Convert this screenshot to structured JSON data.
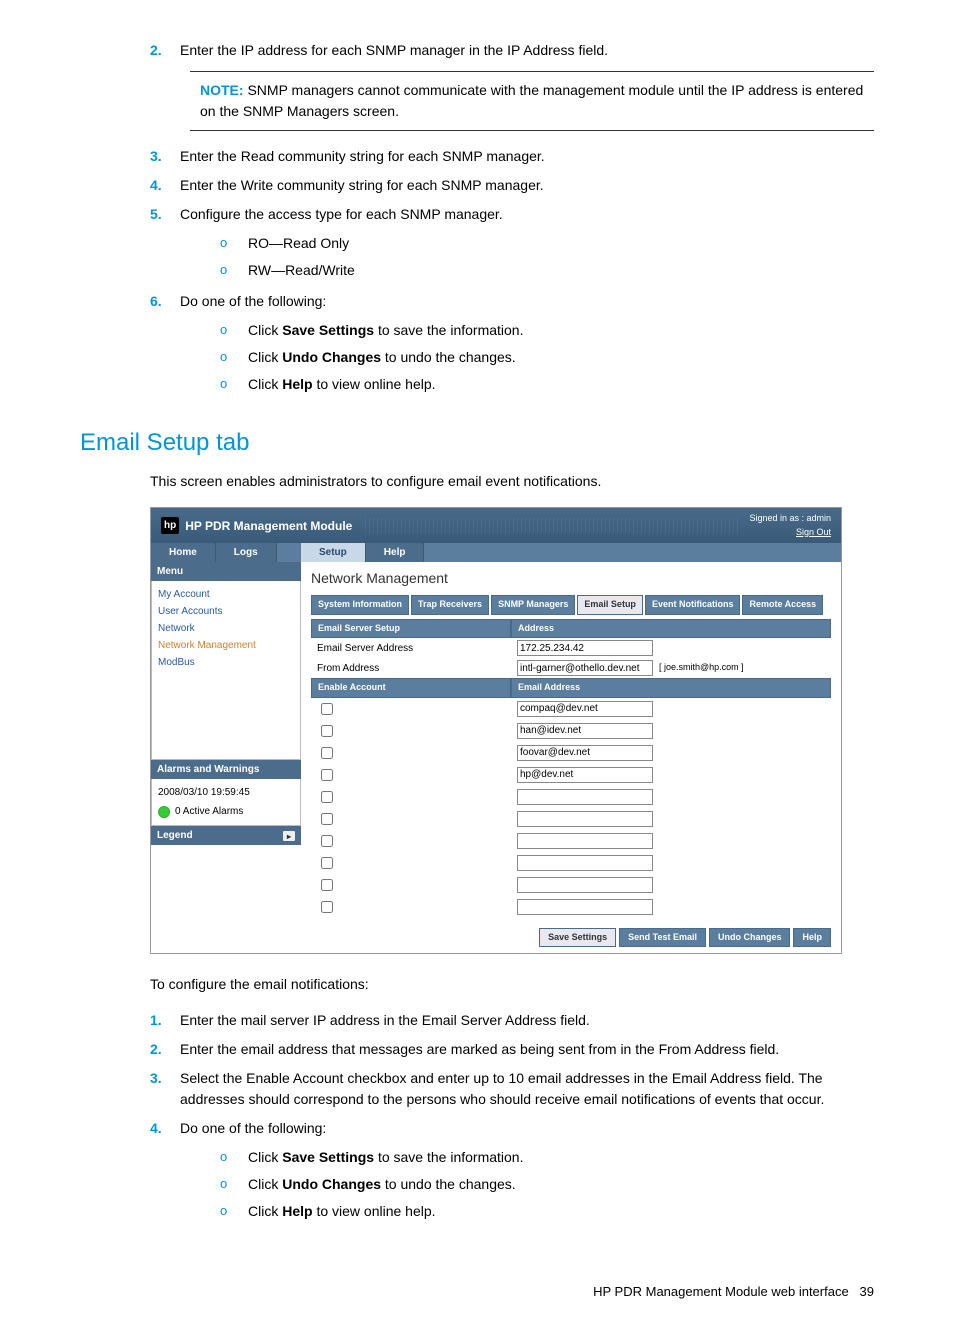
{
  "step2": "Enter the IP address for each SNMP manager in the IP Address field.",
  "note_label": "NOTE:",
  "note_text": "SNMP managers cannot communicate with the management module until the IP address is entered on the SNMP Managers screen.",
  "step3": "Enter the Read community string for each SNMP manager.",
  "step4": "Enter the Write community string for each SNMP manager.",
  "step5": "Configure the access type for each SNMP manager.",
  "step5_a": "RO—Read Only",
  "step5_b": "RW—Read/Write",
  "step6": "Do one of the following:",
  "step6_a_pre": "Click ",
  "step6_a_b": "Save Settings",
  "step6_a_post": " to save the information.",
  "step6_b_pre": "Click ",
  "step6_b_b": "Undo Changes",
  "step6_b_post": " to undo the changes.",
  "step6_c_pre": "Click ",
  "step6_c_b": "Help",
  "step6_c_post": " to view online help.",
  "h2": "Email Setup tab",
  "intro": "This screen enables administrators to configure email event notifications.",
  "shot": {
    "title": "HP PDR Management Module",
    "signin_line1": "Signed in as : admin",
    "signin_line2": "Sign Out",
    "top_tabs": {
      "home": "Home",
      "logs": "Logs",
      "setup": "Setup",
      "help": "Help"
    },
    "menu_title": "Menu",
    "menu": {
      "myaccount": "My Account",
      "useraccounts": "User Accounts",
      "network": "Network",
      "netmgmt": "Network Management",
      "modbus": "ModBus"
    },
    "aw_title": "Alarms and Warnings",
    "aw_time": "2008/03/10 19:59:45",
    "aw_alarms": "0 Active Alarms",
    "legend": "Legend",
    "legend_icon": "▸",
    "nm_title": "Network Management",
    "subtabs": {
      "sysinfo": "System Information",
      "trap": "Trap Receivers",
      "snmp": "SNMP Managers",
      "email": "Email Setup",
      "event": "Event Notifications",
      "remote": "Remote Access"
    },
    "form": {
      "ess": "Email Server Setup",
      "addr": "Address",
      "esa": "Email Server Address",
      "esa_val": "172.25.234.42",
      "from": "From Address",
      "from_val": "intl-garner@othello.dev.net",
      "from_hint": "[ joe.smith@hp.com ]",
      "enable": "Enable Account",
      "emailaddr": "Email Address",
      "rows": [
        "compaq@dev.net",
        "han@idev.net",
        "foovar@dev.net",
        "hp@dev.net",
        "",
        "",
        "",
        "",
        "",
        ""
      ]
    },
    "buttons": {
      "save": "Save Settings",
      "test": "Send Test Email",
      "undo": "Undo Changes",
      "help": "Help"
    }
  },
  "post_intro": "To configure the email notifications:",
  "p1": "Enter the mail server IP address in the Email Server Address field.",
  "p2": "Enter the email address that messages are marked as being sent from in the From Address field.",
  "p3": "Select the Enable Account checkbox and enter up to 10 email addresses in the Email Address field. The addresses should correspond to the persons who should receive email notifications of events that occur.",
  "p4": "Do one of the following:",
  "p4_a_pre": "Click ",
  "p4_a_b": "Save Settings",
  "p4_a_post": " to save the information.",
  "p4_b_pre": "Click ",
  "p4_b_b": "Undo Changes",
  "p4_b_post": " to undo the changes.",
  "p4_c_pre": "Click ",
  "p4_c_b": "Help",
  "p4_c_post": " to view online help.",
  "footer_text": "HP PDR Management Module web interface",
  "footer_page": "39"
}
